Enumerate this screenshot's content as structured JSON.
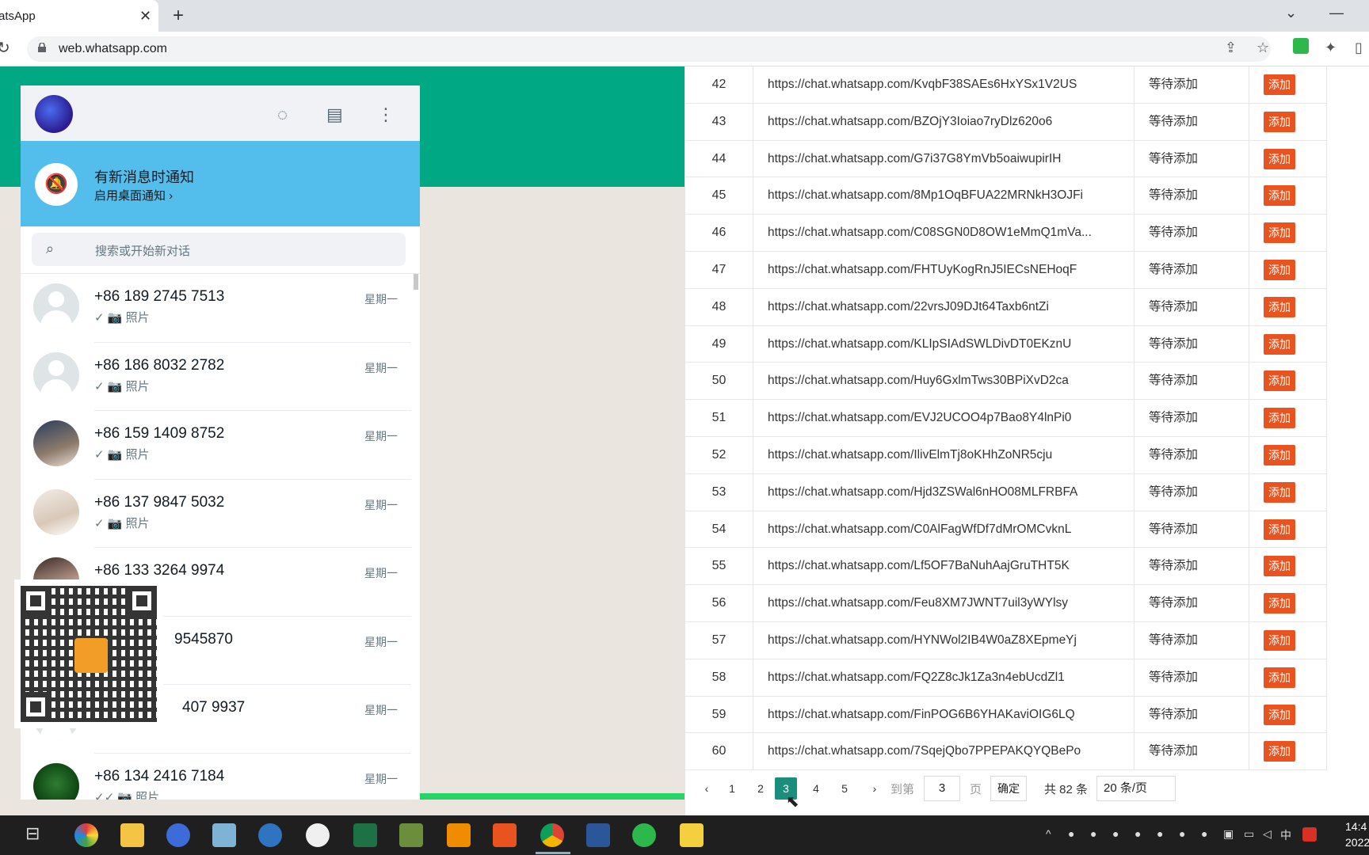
{
  "browser": {
    "tab_title": "atsApp",
    "url": "web.whatsapp.com"
  },
  "whatsapp": {
    "notify_title": "有新消息时通知",
    "notify_sub": "启用桌面通知 ›",
    "search_placeholder": "搜索或开始新对话",
    "chats": [
      {
        "name": "+86 189 2745 7513",
        "time": "星期一",
        "preview": "✓ 📷 照片"
      },
      {
        "name": "+86 186 8032 2782",
        "time": "星期一",
        "preview": "✓ 📷 照片"
      },
      {
        "name": "+86 159 1409 8752",
        "time": "星期一",
        "preview": "✓ 📷 照片"
      },
      {
        "name": "+86 137 9847 5032",
        "time": "星期一",
        "preview": "✓ 📷 照片"
      },
      {
        "name": "+86 133 3264 9974",
        "time": "星期一",
        "preview": ""
      },
      {
        "name": "9545870",
        "time": "星期一",
        "preview": ""
      },
      {
        "name": "407 9937",
        "time": "星期一",
        "preview": ""
      },
      {
        "name": "+86 134 2416 7184",
        "time": "星期一",
        "preview": "✓✓ 📷 照片"
      }
    ]
  },
  "table": {
    "status_label": "等待添加",
    "add_label": "添加",
    "rows": [
      {
        "num": "42",
        "url": "https://chat.whatsapp.com/KvqbF38SAEs6HxYSx1V2US"
      },
      {
        "num": "43",
        "url": "https://chat.whatsapp.com/BZOjY3Ioiao7ryDlz620o6"
      },
      {
        "num": "44",
        "url": "https://chat.whatsapp.com/G7i37G8YmVb5oaiwupirIH"
      },
      {
        "num": "45",
        "url": "https://chat.whatsapp.com/8Mp1OqBFUA22MRNkH3OJFi"
      },
      {
        "num": "46",
        "url": "https://chat.whatsapp.com/C08SGN0D8OW1eMmQ1mVa..."
      },
      {
        "num": "47",
        "url": "https://chat.whatsapp.com/FHTUyKogRnJ5IECsNEHoqF"
      },
      {
        "num": "48",
        "url": "https://chat.whatsapp.com/22vrsJ09DJt64Taxb6ntZi"
      },
      {
        "num": "49",
        "url": "https://chat.whatsapp.com/KLIpSIAdSWLDivDT0EKznU"
      },
      {
        "num": "50",
        "url": "https://chat.whatsapp.com/Huy6GxlmTws30BPiXvD2ca"
      },
      {
        "num": "51",
        "url": "https://chat.whatsapp.com/EVJ2UCOO4p7Bao8Y4lnPi0"
      },
      {
        "num": "52",
        "url": "https://chat.whatsapp.com/IlivElmTj8oKHhZoNR5cju"
      },
      {
        "num": "53",
        "url": "https://chat.whatsapp.com/Hjd3ZSWal6nHO08MLFRBFA"
      },
      {
        "num": "54",
        "url": "https://chat.whatsapp.com/C0AlFagWfDf7dMrOMCvknL"
      },
      {
        "num": "55",
        "url": "https://chat.whatsapp.com/Lf5OF7BaNuhAajGruTHT5K"
      },
      {
        "num": "56",
        "url": "https://chat.whatsapp.com/Feu8XM7JWNT7uil3yWYlsy"
      },
      {
        "num": "57",
        "url": "https://chat.whatsapp.com/HYNWol2IB4W0aZ8XEpmeYj"
      },
      {
        "num": "58",
        "url": "https://chat.whatsapp.com/FQ2Z8cJk1Za3n4ebUcdZl1"
      },
      {
        "num": "59",
        "url": "https://chat.whatsapp.com/FinPOG6B6YHAKaviOIG6LQ"
      },
      {
        "num": "60",
        "url": "https://chat.whatsapp.com/7SqejQbo7PPEPAKQYQBePo"
      }
    ]
  },
  "pager": {
    "pages": [
      "1",
      "2",
      "3",
      "4",
      "5"
    ],
    "current": "3",
    "goto_label": "到第",
    "goto_value": "3",
    "page_unit": "页",
    "confirm_label": "确定",
    "total": "共 82 条",
    "page_size": "20 条/页"
  },
  "taskbar": {
    "time": "14:4",
    "date": "2022/"
  },
  "colors": {
    "whatsapp_green": "#00a884",
    "notify_blue": "#53bdeb",
    "add_button": "#e8531f",
    "pager_active": "#1a8f7e"
  }
}
